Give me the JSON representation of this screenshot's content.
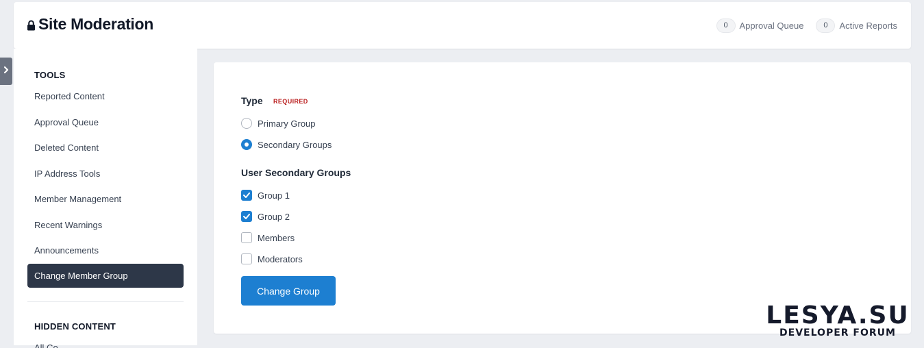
{
  "header": {
    "title": "Site Moderation",
    "stats": [
      {
        "count": "0",
        "label": "Approval Queue"
      },
      {
        "count": "0",
        "label": "Active Reports"
      }
    ]
  },
  "sidebar": {
    "sections": [
      {
        "heading": "TOOLS"
      },
      {
        "heading": "HIDDEN CONTENT"
      }
    ],
    "items": [
      {
        "label": "Reported Content"
      },
      {
        "label": "Approval Queue"
      },
      {
        "label": "Deleted Content"
      },
      {
        "label": "IP Address Tools"
      },
      {
        "label": "Member Management"
      },
      {
        "label": "Recent Warnings"
      },
      {
        "label": "Announcements"
      },
      {
        "label": "Change Member Group",
        "active": true
      }
    ],
    "cutoff_item": "All Co"
  },
  "form": {
    "type_label": "Type",
    "required_label": "REQUIRED",
    "type_options": [
      {
        "label": "Primary Group",
        "checked": false
      },
      {
        "label": "Secondary Groups",
        "checked": true
      }
    ],
    "groups_label": "User Secondary Groups",
    "groups": [
      {
        "label": "Group 1",
        "checked": true
      },
      {
        "label": "Group 2",
        "checked": true
      },
      {
        "label": "Members",
        "checked": false
      },
      {
        "label": "Moderators",
        "checked": false
      }
    ],
    "submit_label": "Change Group"
  },
  "watermark": {
    "logo": "LESYA.SU",
    "subtitle": "DEVELOPER FORUM"
  },
  "colors": {
    "accent": "#1d7fd1",
    "active_nav": "#2d3748",
    "required": "#b91c1c",
    "background": "#eceef2"
  },
  "icons": {
    "title": "lock-icon",
    "toggle": "chevron-right-icon",
    "checkbox": "checkmark-icon"
  }
}
